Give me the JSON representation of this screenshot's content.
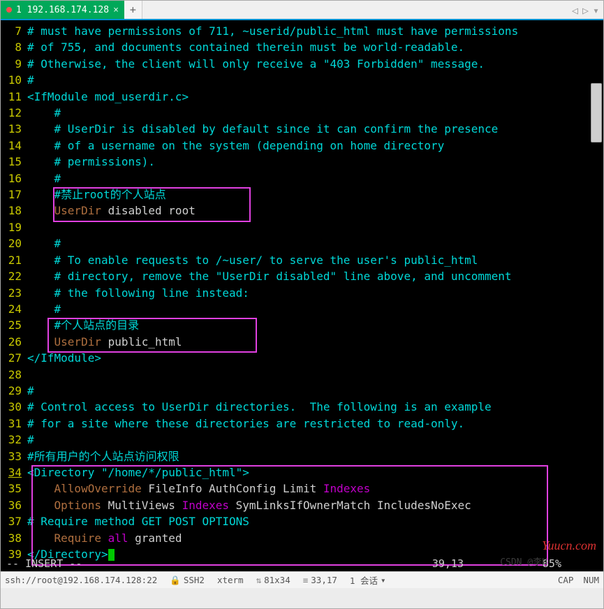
{
  "tab": {
    "title": "1 192.168.174.128",
    "close": "×"
  },
  "newtab": "+",
  "lines": [
    {
      "n": 7,
      "segs": [
        [
          "cm",
          "# must have permissions of 711, ~userid/public_html must have permissions"
        ]
      ]
    },
    {
      "n": 8,
      "segs": [
        [
          "cm",
          "# of 755, and documents contained therein must be world-readable."
        ]
      ]
    },
    {
      "n": 9,
      "segs": [
        [
          "cm",
          "# Otherwise, the client will only receive a \"403 Forbidden\" message."
        ]
      ]
    },
    {
      "n": 10,
      "segs": [
        [
          "cm",
          "#"
        ]
      ]
    },
    {
      "n": 11,
      "segs": [
        [
          "st",
          "<IfModule mod_userdir.c>"
        ]
      ]
    },
    {
      "n": 12,
      "segs": [
        [
          "cm",
          "    #"
        ]
      ]
    },
    {
      "n": 13,
      "segs": [
        [
          "cm",
          "    # UserDir is disabled by default since it can confirm the presence"
        ]
      ]
    },
    {
      "n": 14,
      "segs": [
        [
          "cm",
          "    # of a username on the system (depending on home directory"
        ]
      ]
    },
    {
      "n": 15,
      "segs": [
        [
          "cm",
          "    # permissions)."
        ]
      ]
    },
    {
      "n": 16,
      "segs": [
        [
          "cm",
          "    #"
        ]
      ]
    },
    {
      "n": 17,
      "segs": [
        [
          "cm",
          "    #禁止root的个人站点"
        ]
      ]
    },
    {
      "n": 18,
      "segs": [
        [
          "kw",
          "    UserDir"
        ],
        [
          "wh",
          " disabled root"
        ]
      ]
    },
    {
      "n": 19,
      "segs": [
        [
          "wh",
          ""
        ]
      ]
    },
    {
      "n": 20,
      "segs": [
        [
          "cm",
          "    #"
        ]
      ]
    },
    {
      "n": 21,
      "segs": [
        [
          "cm",
          "    # To enable requests to /~user/ to serve the user's public_html"
        ]
      ]
    },
    {
      "n": 22,
      "segs": [
        [
          "cm",
          "    # directory, remove the \"UserDir disabled\" line above, and uncomment"
        ]
      ]
    },
    {
      "n": 23,
      "segs": [
        [
          "cm",
          "    # the following line instead:"
        ]
      ]
    },
    {
      "n": 24,
      "segs": [
        [
          "cm",
          "    #"
        ]
      ]
    },
    {
      "n": 25,
      "segs": [
        [
          "cm",
          "    #个人站点的目录"
        ]
      ]
    },
    {
      "n": 26,
      "segs": [
        [
          "kw",
          "    UserDir"
        ],
        [
          "wh",
          " public_html"
        ]
      ]
    },
    {
      "n": 27,
      "segs": [
        [
          "st",
          "</IfModule>"
        ]
      ]
    },
    {
      "n": 28,
      "segs": [
        [
          "wh",
          ""
        ]
      ]
    },
    {
      "n": 29,
      "segs": [
        [
          "cm",
          "#"
        ]
      ]
    },
    {
      "n": 30,
      "segs": [
        [
          "cm",
          "# Control access to UserDir directories.  The following is an example"
        ]
      ]
    },
    {
      "n": 31,
      "segs": [
        [
          "cm",
          "# for a site where these directories are restricted to read-only."
        ]
      ]
    },
    {
      "n": 32,
      "segs": [
        [
          "cm",
          "#"
        ]
      ]
    },
    {
      "n": 33,
      "segs": [
        [
          "cm",
          "#所有用户的个人站点访问权限"
        ]
      ]
    },
    {
      "n": 34,
      "segs": [
        [
          "st",
          "<Directory \"/home/*/public_html\">"
        ]
      ],
      "cur": true
    },
    {
      "n": 35,
      "segs": [
        [
          "kw",
          "    AllowOverride"
        ],
        [
          "wh",
          " FileInfo AuthConfig Limit "
        ],
        [
          "id",
          "Indexes"
        ]
      ]
    },
    {
      "n": 36,
      "segs": [
        [
          "kw",
          "    Options"
        ],
        [
          "wh",
          " MultiViews "
        ],
        [
          "id",
          "Indexes"
        ],
        [
          "wh",
          " SymLinksIfOwnerMatch IncludesNoExec"
        ]
      ]
    },
    {
      "n": 37,
      "segs": [
        [
          "cm",
          "# Require method GET POST OPTIONS"
        ]
      ]
    },
    {
      "n": 38,
      "segs": [
        [
          "kw",
          "    Require"
        ],
        [
          "id",
          " all"
        ],
        [
          "wh",
          " granted"
        ]
      ]
    },
    {
      "n": 39,
      "segs": [
        [
          "st",
          "</Directory>"
        ]
      ],
      "cursor": true
    }
  ],
  "vim": {
    "mode": "-- INSERT --",
    "pos": "39,13",
    "pct": "85%"
  },
  "watermark": "Yuucn.com",
  "faint": "CSDN @李H",
  "status": {
    "conn": "ssh://root@192.168.174.128:22",
    "proto": "SSH2",
    "term": "xterm",
    "size": "81x34",
    "cursor": "33,17",
    "session": "1 会话",
    "cap": "CAP",
    "num": "NUM"
  }
}
